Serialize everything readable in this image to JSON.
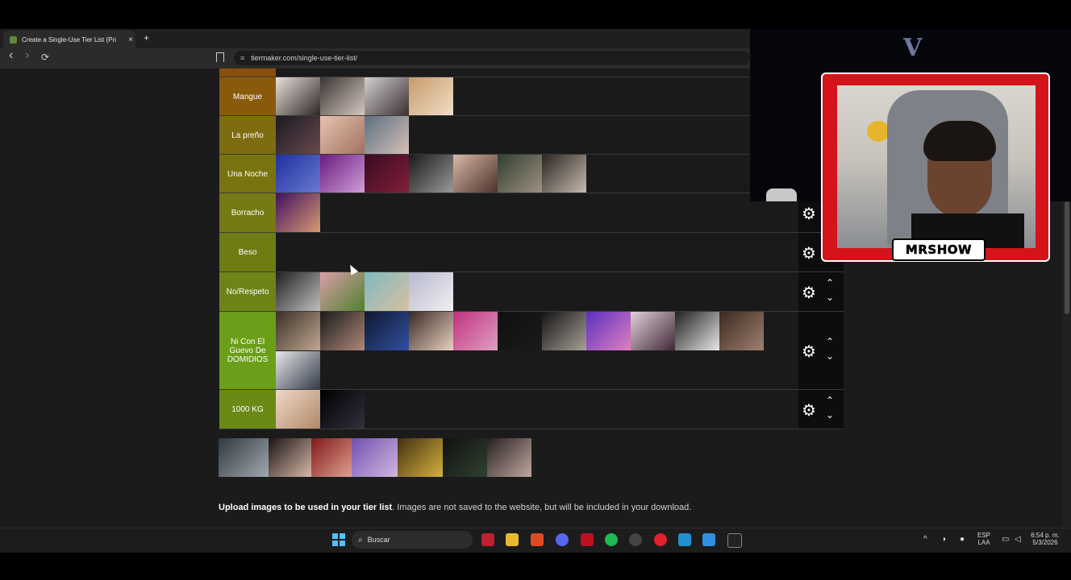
{
  "browser": {
    "tab_title": "Create a Single-Use Tier List (Pri",
    "tab_close": "×",
    "new_tab": "+",
    "back": "‹",
    "forward": "›",
    "reload": "⟳",
    "url": "tiermaker.com/single-use-tier-list/"
  },
  "tiers": [
    {
      "label": "Mangue",
      "color": "#8a5a0c"
    },
    {
      "label": "La preño",
      "color": "#7e6c10"
    },
    {
      "label": "Una Noche",
      "color": "#7a7410"
    },
    {
      "label": "Borracho",
      "color": "#757a12"
    },
    {
      "label": "Beso",
      "color": "#6f7c14"
    },
    {
      "label": "No/Respeto",
      "color": "#6f8416"
    },
    {
      "label": "Ni Con El Guevo De DOMIDIOS",
      "color": "#6b9f1a"
    },
    {
      "label": "1000 KG",
      "color": "#6a8a14"
    }
  ],
  "controls": {
    "gear": "⚙",
    "up": "⌃",
    "down": "⌄"
  },
  "upload": {
    "bold": "Upload images to be used in your tier list",
    "rest": ". Images are not saved to the website, but will be included in your download."
  },
  "stream": {
    "logo": "V",
    "cam_name": "MRSHOW"
  },
  "taskbar": {
    "search_label": "Buscar",
    "lang_top": "ESP",
    "lang_bottom": "LAA",
    "time": "6:54 p. m.",
    "date": "5/3/2026"
  }
}
